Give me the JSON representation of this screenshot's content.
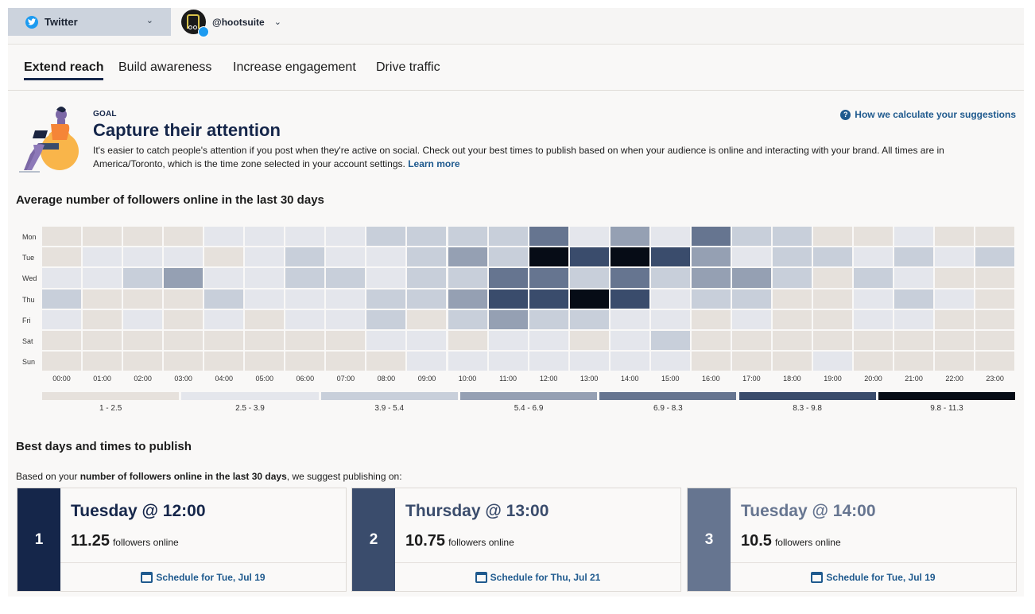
{
  "header": {
    "network": {
      "label": "Twitter",
      "icon": "twitter-icon"
    },
    "account": {
      "handle": "@hootsuite",
      "icon": "chevron-down-icon"
    }
  },
  "tabs": [
    {
      "label": "Extend reach",
      "active": true
    },
    {
      "label": "Build awareness",
      "active": false
    },
    {
      "label": "Increase engagement",
      "active": false
    },
    {
      "label": "Drive traffic",
      "active": false
    }
  ],
  "goal": {
    "eyebrow": "GOAL",
    "title": "Capture their attention",
    "description": "It's easier to catch people's attention if you post when they're active on social. Check out your best times to publish based on when your audience is online and interacting with your brand. All times are in America/Toronto, which is the time zone selected in your account settings.",
    "learn_more": "Learn more",
    "how_link": "How we calculate your suggestions"
  },
  "chart_data": {
    "type": "heatmap",
    "title": "Average number of followers online in the last 30 days",
    "rows": [
      "Mon",
      "Tue",
      "Wed",
      "Thu",
      "Fri",
      "Sat",
      "Sun"
    ],
    "columns": [
      "00:00",
      "01:00",
      "02:00",
      "03:00",
      "04:00",
      "05:00",
      "06:00",
      "07:00",
      "08:00",
      "09:00",
      "10:00",
      "11:00",
      "12:00",
      "13:00",
      "14:00",
      "15:00",
      "16:00",
      "17:00",
      "18:00",
      "19:00",
      "20:00",
      "21:00",
      "22:00",
      "23:00"
    ],
    "value_unit": "bucket index into legend (0 = 1-2.5 ... 6 = 9.8-11.3)",
    "values": [
      [
        0,
        0,
        0,
        0,
        1,
        1,
        1,
        1,
        2,
        2,
        2,
        2,
        4,
        1,
        3,
        1,
        4,
        2,
        2,
        0,
        0,
        1,
        0,
        0
      ],
      [
        0,
        1,
        1,
        1,
        0,
        1,
        2,
        1,
        1,
        2,
        3,
        2,
        6,
        5,
        6,
        5,
        3,
        1,
        2,
        2,
        1,
        2,
        1,
        2
      ],
      [
        1,
        1,
        2,
        3,
        1,
        1,
        2,
        2,
        1,
        2,
        2,
        4,
        4,
        2,
        4,
        2,
        3,
        3,
        2,
        0,
        2,
        1,
        0,
        0
      ],
      [
        2,
        0,
        0,
        0,
        2,
        1,
        1,
        1,
        2,
        2,
        3,
        5,
        5,
        6,
        5,
        1,
        2,
        2,
        0,
        0,
        1,
        2,
        1,
        0
      ],
      [
        1,
        0,
        1,
        0,
        1,
        0,
        1,
        1,
        2,
        0,
        2,
        3,
        2,
        2,
        1,
        1,
        0,
        1,
        0,
        0,
        1,
        1,
        0,
        0
      ],
      [
        0,
        0,
        0,
        0,
        0,
        0,
        0,
        0,
        1,
        1,
        0,
        1,
        1,
        0,
        1,
        2,
        0,
        0,
        0,
        0,
        0,
        0,
        0,
        0
      ],
      [
        0,
        0,
        0,
        0,
        0,
        0,
        0,
        0,
        0,
        1,
        1,
        1,
        1,
        1,
        1,
        1,
        0,
        0,
        0,
        1,
        0,
        0,
        0,
        0
      ]
    ],
    "legend": [
      {
        "range": "1 - 2.5",
        "color": "#e6e1dc"
      },
      {
        "range": "2.5 - 3.9",
        "color": "#e4e6ec"
      },
      {
        "range": "3.9 - 5.4",
        "color": "#c8cfda"
      },
      {
        "range": "5.4 - 6.9",
        "color": "#95a0b3"
      },
      {
        "range": "6.9 - 8.3",
        "color": "#667590"
      },
      {
        "range": "8.3 - 9.8",
        "color": "#3a4c6c"
      },
      {
        "range": "9.8 - 11.3",
        "color": "#060c16"
      }
    ],
    "legend_position": "bottom"
  },
  "best_times": {
    "title": "Best days and times to publish",
    "intro_prefix": "Based on your ",
    "intro_bold": "number of followers online in the last 30 days",
    "intro_suffix": ", we suggest publishing on:",
    "cards": [
      {
        "rank": "1",
        "when": "Tuesday @ 12:00",
        "count": "11.25",
        "count_label": "followers online",
        "schedule": "Schedule for Tue, Jul 19",
        "rank_color": "#15264a",
        "title_color": "#15264a"
      },
      {
        "rank": "2",
        "when": "Thursday @ 13:00",
        "count": "10.75",
        "count_label": "followers online",
        "schedule": "Schedule for Thu, Jul 21",
        "rank_color": "#3a4c6c",
        "title_color": "#3a4c6c"
      },
      {
        "rank": "3",
        "when": "Tuesday @ 14:00",
        "count": "10.5",
        "count_label": "followers online",
        "schedule": "Schedule for Tue, Jul 19",
        "rank_color": "#667590",
        "title_color": "#667590"
      }
    ]
  }
}
